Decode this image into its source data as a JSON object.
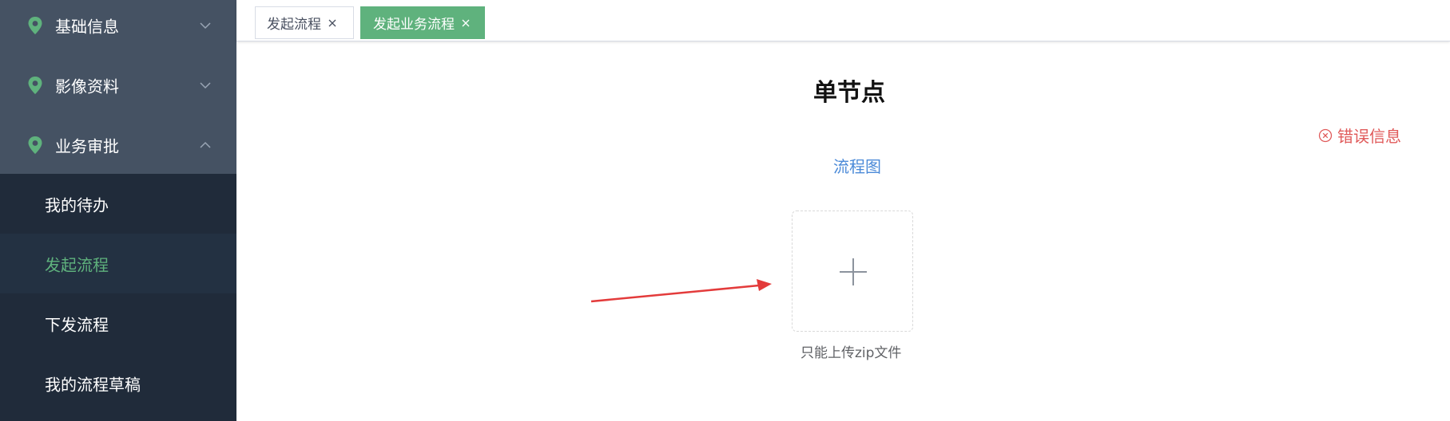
{
  "sidebar": {
    "menu": [
      {
        "label": "基础信息",
        "expanded": false
      },
      {
        "label": "影像资料",
        "expanded": false
      },
      {
        "label": "业务审批",
        "expanded": true
      }
    ],
    "submenu": [
      {
        "label": "我的待办",
        "active": false
      },
      {
        "label": "发起流程",
        "active": true
      },
      {
        "label": "下发流程",
        "active": false
      },
      {
        "label": "我的流程草稿",
        "active": false
      }
    ]
  },
  "tabs": [
    {
      "label": "发起流程",
      "active": false
    },
    {
      "label": "发起业务流程",
      "active": true
    }
  ],
  "main": {
    "title": "单节点",
    "error_label": "错误信息",
    "flow_link": "流程图",
    "upload_tip": "只能上传zip文件"
  },
  "colors": {
    "sidebar_bg": "#304156",
    "submenu_bg": "#202b3a",
    "accent_green": "#5fb27d",
    "link_blue": "#4b8ad8",
    "error_red": "#e05a5a",
    "arrow_red": "#e33b3b"
  },
  "icons": {
    "menu_icon": "map-pin-icon",
    "collapse": "chevron-up-icon",
    "expand": "chevron-down-icon",
    "tab_close": "close-icon",
    "error": "circle-x-icon",
    "upload": "plus-icon"
  }
}
